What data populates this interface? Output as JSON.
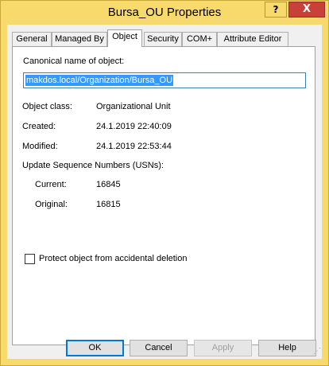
{
  "window": {
    "title": "Bursa_OU Properties",
    "help_label": "?",
    "close_label": "X"
  },
  "tabs": [
    {
      "label": "General"
    },
    {
      "label": "Managed By"
    },
    {
      "label": "Object",
      "active": true
    },
    {
      "label": "Security"
    },
    {
      "label": "COM+"
    },
    {
      "label": "Attribute Editor"
    }
  ],
  "object": {
    "canonical_label": "Canonical name of object:",
    "canonical_value": "makdos.local/Organization/Bursa_OU",
    "class_label": "Object class:",
    "class_value": "Organizational Unit",
    "created_label": "Created:",
    "created_value": "24.1.2019 22:40:09",
    "modified_label": "Modified:",
    "modified_value": "24.1.2019 22:53:44",
    "usn_label": "Update Sequence Numbers (USNs):",
    "current_label": "Current:",
    "current_value": "16845",
    "original_label": "Original:",
    "original_value": "16815",
    "protect_label": "Protect object from accidental deletion",
    "protect_checked": false
  },
  "buttons": {
    "ok": "OK",
    "cancel": "Cancel",
    "apply": "Apply",
    "help": "Help"
  },
  "colors": {
    "titlebar": "#f7da6b",
    "close": "#c7403a",
    "selection": "#3399ff"
  }
}
